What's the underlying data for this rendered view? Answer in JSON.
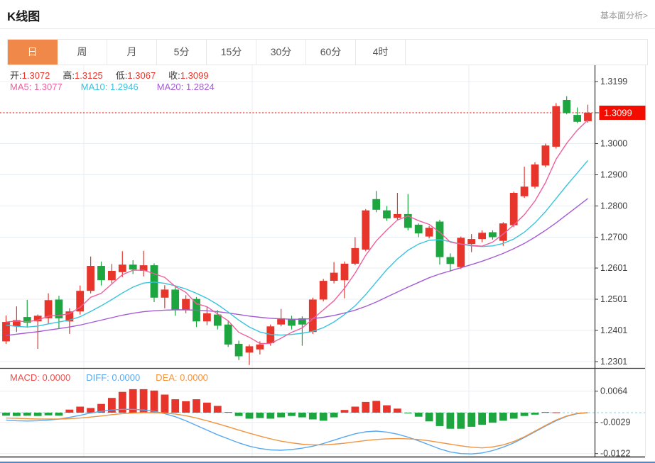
{
  "header": {
    "title": "K线图",
    "link": "基本面分析>"
  },
  "tabs": {
    "items": [
      "日",
      "周",
      "月",
      "5分",
      "15分",
      "30分",
      "60分",
      "4时"
    ],
    "active_index": 0
  },
  "legend": {
    "open_label": "开:",
    "open": "1.3072",
    "high_label": "高:",
    "high": "1.3125",
    "low_label": "低:",
    "low": "1.3067",
    "close_label": "收:",
    "close": "1.3099",
    "ma5_label": "MA5:",
    "ma5": "1.3077",
    "ma10_label": "MA10:",
    "ma10": "1.2946",
    "ma20_label": "MA20:",
    "ma20": "1.2824"
  },
  "macd_legend": {
    "macd_label": "MACD:",
    "macd": "0.0000",
    "diff_label": "DIFF:",
    "diff": "0.0000",
    "dea_label": "DEA:",
    "dea": "0.0000"
  },
  "colors": {
    "up": "#e7352b",
    "down": "#1da53f",
    "ma5": "#ef5f9d",
    "ma10": "#39c3dd",
    "ma20": "#a55bd5",
    "diff": "#58a8f0",
    "dea": "#f2933f",
    "grid": "#e9eef4",
    "axis": "#3c3c3c",
    "label": "#404040",
    "last_price_line": "#f0382b",
    "last_price_bg": "#f30d00",
    "zero_dash": "#a6d8ea",
    "tab_accent": "#f0884a",
    "bottom_bar": "#4d88d8"
  },
  "chart_data": [
    {
      "type": "candlestick",
      "pane": "main",
      "title": "K线图 (日)",
      "legend_position": "top-left",
      "grid": true,
      "y_axis": {
        "labels": [
          "1.3199",
          "1.3099",
          "1.3000",
          "1.2900",
          "1.2800",
          "1.2700",
          "1.2601",
          "1.2501",
          "1.2401",
          "1.2301"
        ],
        "values": [
          1.3199,
          1.3099,
          1.3,
          1.29,
          1.28,
          1.27,
          1.2601,
          1.2501,
          1.2401,
          1.2301
        ],
        "highlight_label": "1.3099"
      },
      "last_price": 1.3099,
      "ohlc_legend": {
        "open": 1.3072,
        "high": 1.3125,
        "low": 1.3067,
        "close": 1.3099
      },
      "ma_legend": {
        "ma5": 1.3077,
        "ma10": 1.2946,
        "ma20": 1.2824
      },
      "candles_ohlc": [
        [
          1.2366,
          1.2449,
          1.2358,
          1.2428
        ],
        [
          1.2414,
          1.2478,
          1.2396,
          1.2434
        ],
        [
          1.2444,
          1.2499,
          1.241,
          1.2426
        ],
        [
          1.243,
          1.2452,
          1.2342,
          1.2448
        ],
        [
          1.244,
          1.252,
          1.2422,
          1.2498
        ],
        [
          1.25,
          1.2512,
          1.2406,
          1.244
        ],
        [
          1.243,
          1.2472,
          1.239,
          1.2462
        ],
        [
          1.2462,
          1.2545,
          1.2452,
          1.2528
        ],
        [
          1.2528,
          1.2638,
          1.252,
          1.2608
        ],
        [
          1.2608,
          1.2622,
          1.2545,
          1.2562
        ],
        [
          1.2562,
          1.2614,
          1.2552,
          1.2592
        ],
        [
          1.2588,
          1.2655,
          1.2572,
          1.2612
        ],
        [
          1.2612,
          1.2626,
          1.2582,
          1.2596
        ],
        [
          1.2592,
          1.2656,
          1.2574,
          1.261
        ],
        [
          1.261,
          1.2616,
          1.2492,
          1.2506
        ],
        [
          1.2506,
          1.2546,
          1.2472,
          1.2532
        ],
        [
          1.2532,
          1.254,
          1.2448,
          1.2466
        ],
        [
          1.2466,
          1.2514,
          1.2456,
          1.2502
        ],
        [
          1.2502,
          1.2508,
          1.2412,
          1.243
        ],
        [
          1.243,
          1.2476,
          1.2418,
          1.2456
        ],
        [
          1.2452,
          1.2466,
          1.2404,
          1.2416
        ],
        [
          1.242,
          1.2432,
          1.2348,
          1.2356
        ],
        [
          1.2358,
          1.2368,
          1.2306,
          1.2318
        ],
        [
          1.233,
          1.2356,
          1.229,
          1.235
        ],
        [
          1.234,
          1.2366,
          1.2324,
          1.2356
        ],
        [
          1.236,
          1.242,
          1.2352,
          1.2414
        ],
        [
          1.242,
          1.247,
          1.2414,
          1.244
        ],
        [
          1.2438,
          1.2448,
          1.2404,
          1.2416
        ],
        [
          1.244,
          1.2446,
          1.2352,
          1.242
        ],
        [
          1.2396,
          1.2506,
          1.239,
          1.25
        ],
        [
          1.25,
          1.2566,
          1.2494,
          1.256
        ],
        [
          1.256,
          1.262,
          1.2552,
          1.2586
        ],
        [
          1.2562,
          1.2622,
          1.2504,
          1.2615
        ],
        [
          1.2615,
          1.27,
          1.261,
          1.2665
        ],
        [
          1.266,
          1.279,
          1.2655,
          1.2786
        ],
        [
          1.2822,
          1.2848,
          1.278,
          1.2788
        ],
        [
          1.2786,
          1.28,
          1.2752,
          1.276
        ],
        [
          1.2762,
          1.2842,
          1.2756,
          1.2774
        ],
        [
          1.2774,
          1.2838,
          1.2722,
          1.273
        ],
        [
          1.274,
          1.2744,
          1.27,
          1.2712
        ],
        [
          1.2702,
          1.2736,
          1.2696,
          1.273
        ],
        [
          1.275,
          1.2756,
          1.2612,
          1.2636
        ],
        [
          1.2636,
          1.2648,
          1.259,
          1.2614
        ],
        [
          1.2604,
          1.2702,
          1.2598,
          1.2698
        ],
        [
          1.2678,
          1.271,
          1.2652,
          1.2694
        ],
        [
          1.2694,
          1.2722,
          1.2684,
          1.2714
        ],
        [
          1.2716,
          1.2722,
          1.2692,
          1.27
        ],
        [
          1.2688,
          1.2748,
          1.2672,
          1.2744
        ],
        [
          1.2738,
          1.2846,
          1.2732,
          1.2842
        ],
        [
          1.2831,
          1.2926,
          1.2826,
          1.2862
        ],
        [
          1.2862,
          1.294,
          1.2856,
          1.2933
        ],
        [
          1.293,
          1.3,
          1.2924,
          1.2994
        ],
        [
          1.299,
          1.313,
          1.2984,
          1.312
        ],
        [
          1.314,
          1.3152,
          1.3094,
          1.3098
        ],
        [
          1.3092,
          1.3116,
          1.3066,
          1.307
        ],
        [
          1.3072,
          1.3125,
          1.3067,
          1.3099
        ]
      ],
      "ma5_line": [
        1.2428,
        1.2431,
        1.2429,
        1.2434,
        1.2447,
        1.2449,
        1.2455,
        1.2475,
        1.2507,
        1.252,
        1.255,
        1.258,
        1.2594,
        1.2594,
        1.2583,
        1.2571,
        1.2542,
        1.2523,
        1.2487,
        1.2477,
        1.2454,
        1.2432,
        1.2395,
        1.2379,
        1.2359,
        1.2359,
        1.2376,
        1.2395,
        1.2409,
        1.2438,
        1.2467,
        1.2496,
        1.2536,
        1.2585,
        1.2642,
        1.2688,
        1.2723,
        1.2755,
        1.2768,
        1.2753,
        1.2741,
        1.2716,
        1.2684,
        1.2678,
        1.2674,
        1.2671,
        1.2684,
        1.271,
        1.2739,
        1.2772,
        1.2816,
        1.2875,
        1.295,
        1.3001,
        1.3043,
        1.3076
      ],
      "ma10_line": [
        1.2418,
        1.2414,
        1.2412,
        1.2415,
        1.2422,
        1.2428,
        1.2434,
        1.2445,
        1.2462,
        1.248,
        1.25,
        1.2521,
        1.254,
        1.2553,
        1.2556,
        1.2552,
        1.2544,
        1.2534,
        1.252,
        1.2504,
        1.2484,
        1.246,
        1.2434,
        1.2412,
        1.2396,
        1.2388,
        1.2386,
        1.2388,
        1.2392,
        1.2398,
        1.241,
        1.2428,
        1.2452,
        1.248,
        1.2516,
        1.2556,
        1.2596,
        1.263,
        1.2658,
        1.2678,
        1.269,
        1.2692,
        1.2686,
        1.2678,
        1.2672,
        1.267,
        1.2672,
        1.268,
        1.2694,
        1.2716,
        1.2746,
        1.2782,
        1.2824,
        1.2866,
        1.2906,
        1.2946
      ],
      "ma20_line": [
        1.2385,
        1.2389,
        1.2393,
        1.2397,
        1.2402,
        1.2407,
        1.2412,
        1.2418,
        1.2426,
        1.2434,
        1.2442,
        1.245,
        1.2456,
        1.2461,
        1.2464,
        1.2466,
        1.2467,
        1.2467,
        1.2466,
        1.2464,
        1.2461,
        1.2457,
        1.2452,
        1.2447,
        1.2443,
        1.244,
        1.2438,
        1.2437,
        1.2437,
        1.2439,
        1.2443,
        1.2449,
        1.2457,
        1.2466,
        1.2478,
        1.2492,
        1.2508,
        1.2524,
        1.254,
        1.2555,
        1.257,
        1.2582,
        1.2592,
        1.2602,
        1.2612,
        1.2623,
        1.2635,
        1.2648,
        1.2663,
        1.268,
        1.27,
        1.2722,
        1.2746,
        1.2772,
        1.2798,
        1.2824
      ]
    },
    {
      "type": "bar",
      "pane": "macd",
      "title": "MACD",
      "y_axis": {
        "labels": [
          "0.0064",
          "-0.0029",
          "-0.0122"
        ],
        "values": [
          0.0064,
          -0.0029,
          -0.0122
        ]
      },
      "macd_legend_values": {
        "macd": 0.0,
        "diff": 0.0,
        "dea": 0.0
      },
      "hist": [
        -0.0009,
        -0.001,
        -0.0009,
        -0.001,
        -0.0008,
        -0.0009,
        0.0009,
        0.0018,
        0.0014,
        0.0026,
        0.0044,
        0.0062,
        0.007,
        0.007,
        0.0066,
        0.0054,
        0.004,
        0.0034,
        0.004,
        0.003,
        0.002,
        0.0002,
        -0.001,
        -0.0018,
        -0.0016,
        -0.0018,
        -0.0014,
        -0.001,
        -0.0014,
        -0.002,
        -0.0024,
        -0.0014,
        0.0008,
        0.0018,
        0.0032,
        0.0035,
        0.0022,
        0.0012,
        -0.0002,
        -0.0012,
        -0.0026,
        -0.004,
        -0.0048,
        -0.0048,
        -0.0042,
        -0.0036,
        -0.003,
        -0.0024,
        -0.0018,
        -0.001,
        -0.0006,
        0.0002,
        0.0001,
        0.0,
        0.0,
        0.0
      ],
      "diff_line": [
        -0.0022,
        -0.0024,
        -0.0025,
        -0.0024,
        -0.0022,
        -0.0019,
        -0.0014,
        -0.0008,
        -0.0001,
        0.0004,
        0.0008,
        0.001,
        0.001,
        0.0008,
        0.0004,
        -0.0003,
        -0.0012,
        -0.0024,
        -0.0038,
        -0.0052,
        -0.0066,
        -0.0078,
        -0.009,
        -0.01,
        -0.0107,
        -0.0111,
        -0.0112,
        -0.011,
        -0.0106,
        -0.01,
        -0.0092,
        -0.0082,
        -0.0072,
        -0.0063,
        -0.0057,
        -0.0055,
        -0.0058,
        -0.0064,
        -0.0073,
        -0.0084,
        -0.0096,
        -0.0108,
        -0.0117,
        -0.0122,
        -0.0123,
        -0.012,
        -0.0113,
        -0.0103,
        -0.009,
        -0.0074,
        -0.0057,
        -0.004,
        -0.0024,
        -0.0011,
        -0.0003,
        0.0
      ],
      "dea_line": [
        -0.0016,
        -0.0017,
        -0.0018,
        -0.0019,
        -0.0019,
        -0.0019,
        -0.0018,
        -0.0016,
        -0.0013,
        -0.001,
        -0.0006,
        -0.0003,
        -0.0001,
        0.0,
        0.0,
        -0.0001,
        -0.0004,
        -0.0009,
        -0.0016,
        -0.0024,
        -0.0033,
        -0.0042,
        -0.0052,
        -0.0061,
        -0.007,
        -0.0078,
        -0.0085,
        -0.009,
        -0.0094,
        -0.0096,
        -0.0096,
        -0.0094,
        -0.0091,
        -0.0087,
        -0.0083,
        -0.008,
        -0.0078,
        -0.0077,
        -0.0078,
        -0.008,
        -0.0084,
        -0.0089,
        -0.0094,
        -0.0099,
        -0.0103,
        -0.0105,
        -0.0102,
        -0.0096,
        -0.0086,
        -0.0072,
        -0.0055,
        -0.0038,
        -0.0022,
        -0.001,
        -0.0002,
        0.0
      ]
    }
  ]
}
